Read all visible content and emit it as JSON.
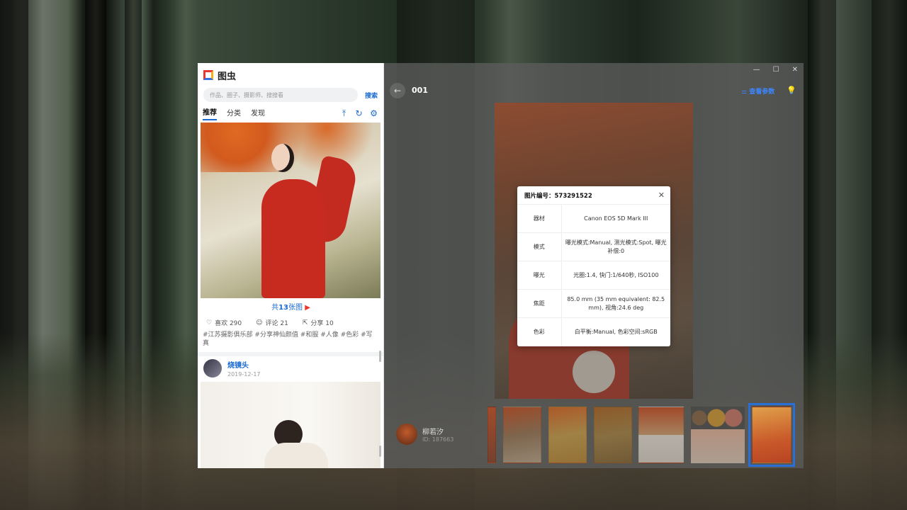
{
  "app": {
    "title": "图虫"
  },
  "search": {
    "placeholder": "作品、圈子、摄影师、搜搜看",
    "button": "搜索"
  },
  "tabs": [
    {
      "label": "推荐",
      "active": true
    },
    {
      "label": "分类",
      "active": false
    },
    {
      "label": "发现",
      "active": false
    }
  ],
  "toolbar_icons": [
    "pin-top-icon",
    "refresh-icon",
    "gear-icon"
  ],
  "post1": {
    "more_prefix": "共",
    "more_count": "13",
    "more_suffix": "张图",
    "likes": "喜欢 290",
    "comments": "评论 21",
    "shares": "分享 10",
    "tags": "#江苏摄影俱乐部 #分享神仙颜值 #和服 #人像 #色彩 #写真"
  },
  "post2": {
    "user": "烧镜头",
    "date": "2019-12-17"
  },
  "viewer": {
    "title": "001",
    "view_params": "查看参数",
    "author": {
      "name": "柳若汐",
      "id": "ID: 187663"
    }
  },
  "exif_dialog": {
    "title": "图片编号：573291522",
    "rows": [
      {
        "key": "器材",
        "value": "Canon EOS 5D Mark III"
      },
      {
        "key": "模式",
        "value": "曝光模式:Manual, 测光模式:Spot, 曝光补偿:0"
      },
      {
        "key": "曝光",
        "value": "光圈:1.4, 快门:1/640秒, ISO100"
      },
      {
        "key": "焦距",
        "value": "85.0 mm (35 mm equivalent: 82.5 mm), 视角:24.6 deg"
      },
      {
        "key": "色彩",
        "value": "白平衡:Manual, 色彩空间:sRGB"
      }
    ]
  },
  "colors": {
    "accent": "#1b6ad2",
    "params_link": "#3d86ff",
    "selected_thumb": "#2a6fd6",
    "dress_red": "#c72a1f"
  }
}
